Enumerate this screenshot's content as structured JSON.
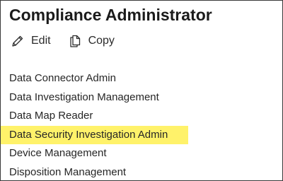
{
  "panel": {
    "title": "Compliance Administrator"
  },
  "toolbar": {
    "edit_label": "Edit",
    "edit_icon": "pencil-icon",
    "copy_label": "Copy",
    "copy_icon": "copy-icon"
  },
  "roles": [
    {
      "label": "Data Connector Admin",
      "highlighted": false
    },
    {
      "label": "Data Investigation Management",
      "highlighted": false
    },
    {
      "label": "Data Map Reader",
      "highlighted": false
    },
    {
      "label": "Data Security Investigation Admin",
      "highlighted": true
    },
    {
      "label": "Device Management",
      "highlighted": false
    },
    {
      "label": "Disposition Management",
      "highlighted": false
    }
  ],
  "colors": {
    "highlight": "#fff26a",
    "text": "#262626"
  }
}
